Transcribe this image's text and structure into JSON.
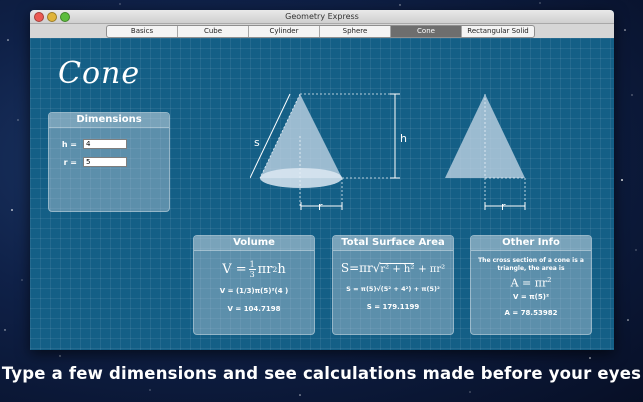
{
  "window": {
    "title": "Geometry Express"
  },
  "tabs": [
    {
      "label": "Basics",
      "active": false
    },
    {
      "label": "Cube",
      "active": false
    },
    {
      "label": "Cylinder",
      "active": false
    },
    {
      "label": "Sphere",
      "active": false
    },
    {
      "label": "Cone",
      "active": true
    },
    {
      "label": "Rectangular Solid",
      "active": false
    }
  ],
  "page_title": "Cone",
  "dimensions": {
    "heading": "Dimensions",
    "h_label": "h =",
    "h_value": "4",
    "r_label": "r =",
    "r_value": "5"
  },
  "diagram": {
    "label_s": "s",
    "label_h": "h",
    "label_r": "r",
    "label_r2": "r"
  },
  "volume": {
    "heading": "Volume",
    "formula_v": "V =",
    "formula_num": "1",
    "formula_den": "3",
    "formula_rest_pi": "πr",
    "formula_rest_2": "2",
    "formula_rest_h": "h",
    "step": "V = (1/3)π(5)²(4 )",
    "result": "V = 104.7198"
  },
  "surface": {
    "heading": "Total Surface Area",
    "formula_a": "S=πr",
    "formula_b": "r² + h²",
    "formula_c": "+ πr²",
    "step": "S = π(5)√(5² + 4²) + π(5)²",
    "result": "S = 179.1199"
  },
  "other": {
    "heading": "Other Info",
    "text": "The cross section of a cone is a triangle, the area is",
    "formula_a": "A = πr",
    "formula_exp": "2",
    "step": "V = π(5)²",
    "result": "A = 78.53982"
  },
  "caption": "Type a few dimensions and see calculations made before your eyes"
}
